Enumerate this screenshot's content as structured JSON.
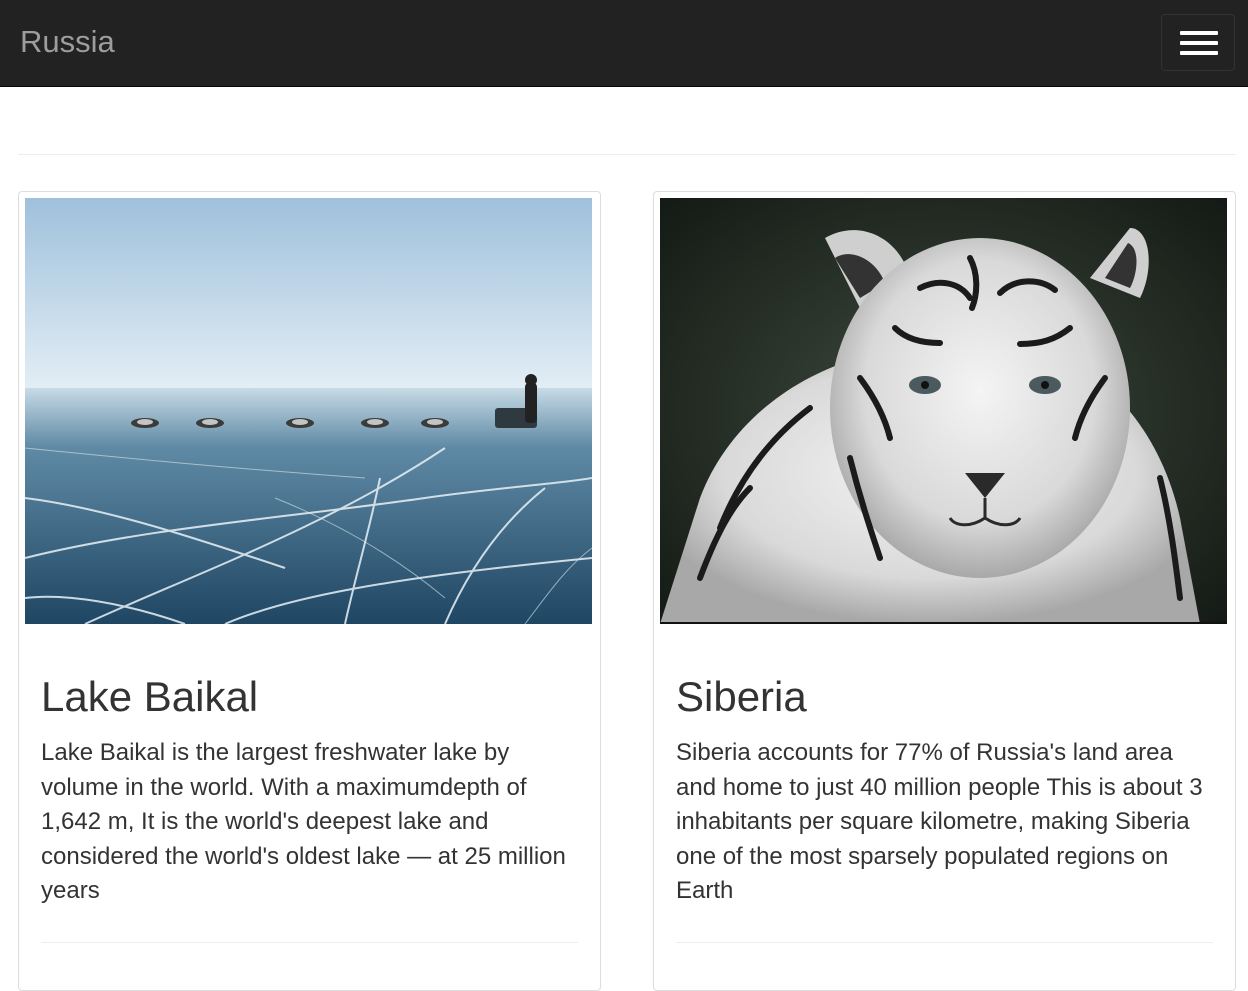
{
  "navbar": {
    "brand": "Russia",
    "toggle_icon": "hamburger-menu-icon"
  },
  "cards": [
    {
      "image_subject": "dog-sled-on-frozen-lake",
      "title": "Lake Baikal",
      "text": "Lake Baikal is the largest freshwater lake by volume in the world. With a maximumdepth of 1,642 m, It is the world's deepest lake and considered the world's oldest lake — at 25 million years"
    },
    {
      "image_subject": "white-tiger",
      "title": "Siberia",
      "text": "Siberia accounts for 77% of Russia's land area and home to just 40 million people This is about 3 inhabitants per square kilometre, making Siberia one of the most sparsely populated regions on Earth"
    }
  ],
  "colors": {
    "navbar_bg": "#222222",
    "brand": "#9d9d9d",
    "text": "#333333",
    "border": "#dddddd"
  }
}
